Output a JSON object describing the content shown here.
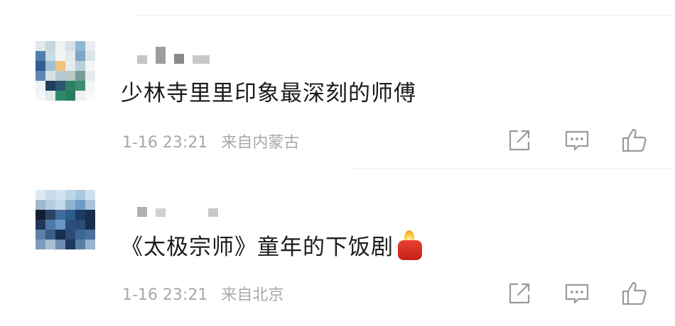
{
  "comments": [
    {
      "text": "少林寺里里印象最深刻的师傅",
      "time": "1-16 23:21",
      "location": "来自内蒙古",
      "emoji": ""
    },
    {
      "text": "《太极宗师》童年的下饭剧",
      "time": "1-16 23:21",
      "location": "来自北京",
      "emoji": "candle-emoji"
    }
  ],
  "actions": {
    "share_icon": "share-icon",
    "reply_icon": "comment-icon",
    "like_icon": "thumbs-up-icon"
  },
  "colors": {
    "text": "#1b1b1b",
    "meta": "#a8a8a8",
    "icon": "#9a9a9a",
    "divider": "#efefef"
  }
}
